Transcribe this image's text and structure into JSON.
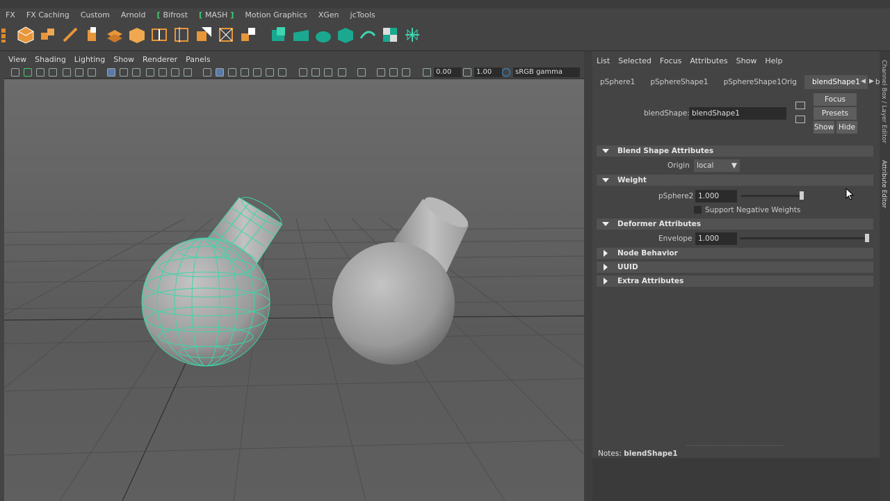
{
  "shelf_tabs": [
    "FX",
    "FX Caching",
    "Custom",
    "Arnold",
    "Bifrost",
    "MASH",
    "Motion Graphics",
    "XGen",
    "jcTools"
  ],
  "viewport": {
    "menus": [
      "View",
      "Shading",
      "Lighting",
      "Show",
      "Renderer",
      "Panels"
    ],
    "exposure_value": "0.00",
    "gamma_value": "1.00",
    "color_space": "sRGB gamma"
  },
  "attribute_editor": {
    "menus": [
      "List",
      "Selected",
      "Focus",
      "Attributes",
      "Show",
      "Help"
    ],
    "tabs": [
      "pSphere1",
      "pSphereShape1",
      "pSphereShape1Orig",
      "blendShape1",
      "b"
    ],
    "active_tab_index": 3,
    "node_label": "blendShape:",
    "node_value": "blendShape1",
    "buttons": {
      "focus": "Focus",
      "presets": "Presets",
      "show": "Show",
      "hide": "Hide"
    },
    "sections": {
      "blend_shape_attributes": "Blend Shape Attributes",
      "weight": "Weight",
      "deformer_attributes": "Deformer Attributes",
      "node_behavior": "Node Behavior",
      "uuid": "UUID",
      "extra_attributes": "Extra Attributes"
    },
    "origin_label": "Origin",
    "origin_value": "local",
    "psphere2_label": "pSphere2",
    "psphere2_value": "1.000",
    "psphere2_fraction": 1.0,
    "support_negative_label": "Support Negative Weights",
    "envelope_label": "Envelope",
    "envelope_value": "1.000",
    "envelope_fraction": 1.0,
    "notes_label": "Notes:",
    "notes_value": "blendShape1"
  },
  "side_tabs": [
    "Channel Box / Layer Editor",
    "Attribute Editor"
  ],
  "colors": {
    "wireframe": "#3cd6a8",
    "bracket": "#3cd06c",
    "highlight": "#2f8fd8"
  }
}
